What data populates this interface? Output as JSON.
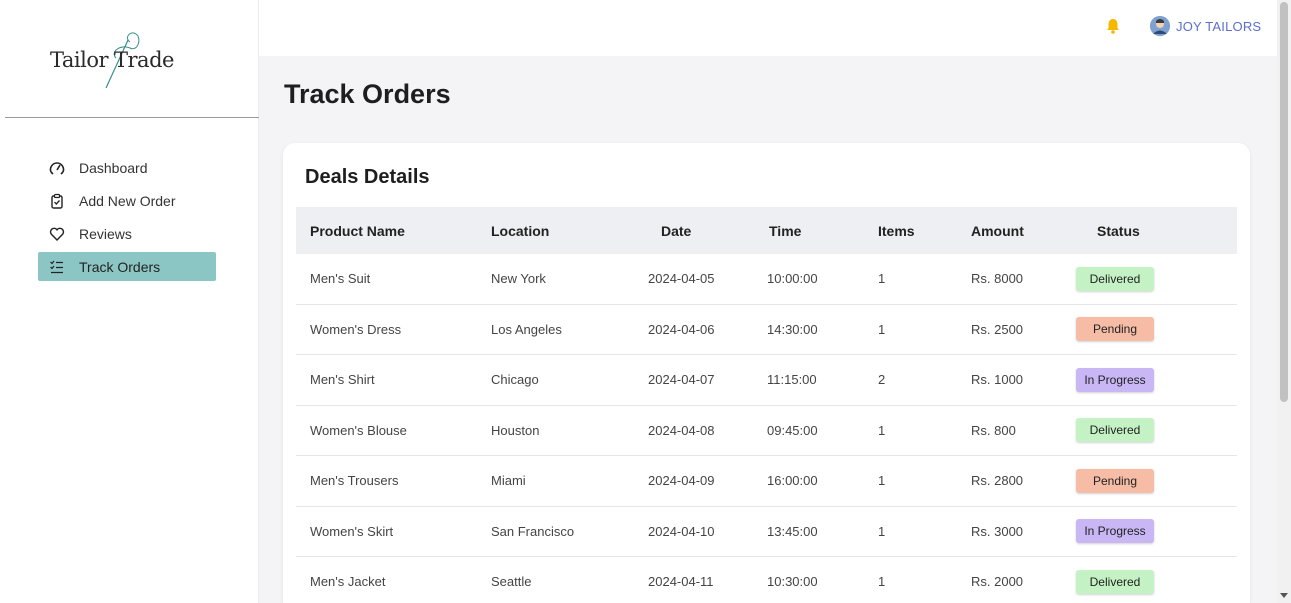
{
  "brand": {
    "name_part1": "Tailor",
    "name_part2": "Trade"
  },
  "sidebar": {
    "items": [
      {
        "label": "Dashboard",
        "icon": "gauge-icon",
        "active": false
      },
      {
        "label": "Add New Order",
        "icon": "clipboard-icon",
        "active": false
      },
      {
        "label": "Reviews",
        "icon": "heart-icon",
        "active": false
      },
      {
        "label": "Track Orders",
        "icon": "checklist-icon",
        "active": true
      }
    ]
  },
  "topbar": {
    "user_name": "JOY TAILORS",
    "bell_color": "#f5b800"
  },
  "page": {
    "title": "Track Orders"
  },
  "card": {
    "title": "Deals Details"
  },
  "table": {
    "headers": [
      "Product Name",
      "Location",
      "Date",
      "Time",
      "Items",
      "Amount",
      "Status"
    ],
    "rows": [
      {
        "product": "Men's Suit",
        "location": "New York",
        "date": "2024-04-05",
        "time": "10:00:00",
        "items": "1",
        "amount": "Rs. 8000",
        "status": "Delivered"
      },
      {
        "product": "Women's Dress",
        "location": "Los Angeles",
        "date": "2024-04-06",
        "time": "14:30:00",
        "items": "1",
        "amount": "Rs. 2500",
        "status": "Pending"
      },
      {
        "product": "Men's Shirt",
        "location": "Chicago",
        "date": "2024-04-07",
        "time": "11:15:00",
        "items": "2",
        "amount": "Rs. 1000",
        "status": "In Progress"
      },
      {
        "product": "Women's Blouse",
        "location": "Houston",
        "date": "2024-04-08",
        "time": "09:45:00",
        "items": "1",
        "amount": "Rs. 800",
        "status": "Delivered"
      },
      {
        "product": "Men's Trousers",
        "location": "Miami",
        "date": "2024-04-09",
        "time": "16:00:00",
        "items": "1",
        "amount": "Rs. 2800",
        "status": "Pending"
      },
      {
        "product": "Women's Skirt",
        "location": "San Francisco",
        "date": "2024-04-10",
        "time": "13:45:00",
        "items": "1",
        "amount": "Rs. 3000",
        "status": "In Progress"
      },
      {
        "product": "Men's Jacket",
        "location": "Seattle",
        "date": "2024-04-11",
        "time": "10:30:00",
        "items": "1",
        "amount": "Rs. 2000",
        "status": "Delivered"
      }
    ]
  },
  "status_colors": {
    "Delivered": "#c4f2c4",
    "Pending": "#f6bca5",
    "In Progress": "#c9b6f4"
  },
  "accent_color": "#8bc6c4"
}
